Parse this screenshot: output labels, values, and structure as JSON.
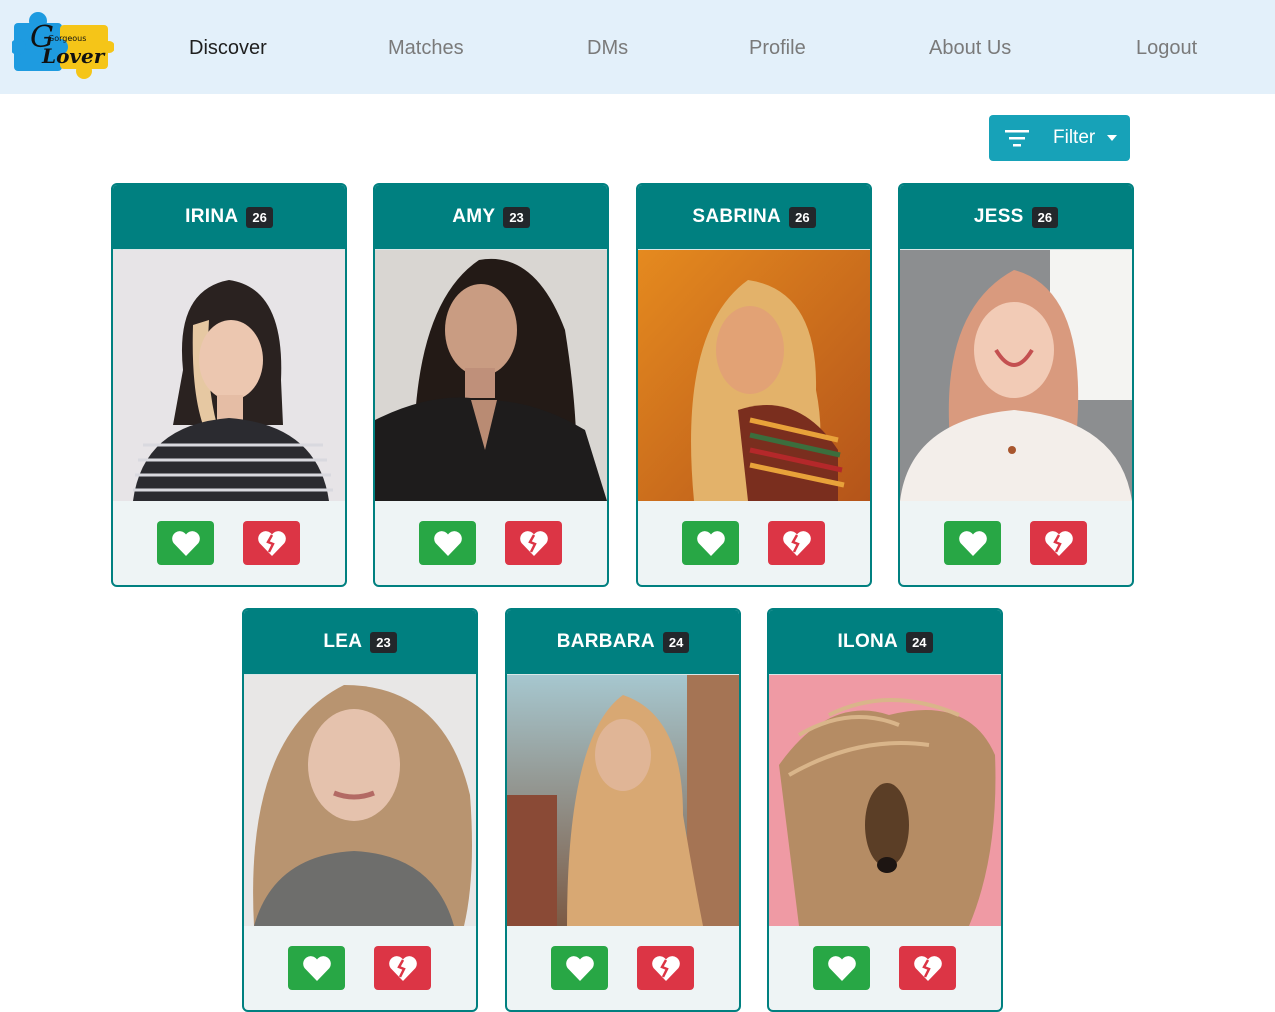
{
  "nav": {
    "items": [
      {
        "label": "Discover",
        "active": true
      },
      {
        "label": "Matches",
        "active": false
      },
      {
        "label": "DMs",
        "active": false
      },
      {
        "label": "Profile",
        "active": false
      },
      {
        "label": "About Us",
        "active": false
      },
      {
        "label": "Logout",
        "active": false
      }
    ],
    "logo_text": "Lover",
    "logo_small_text": "Gorgeous"
  },
  "filter": {
    "label": "Filter",
    "icon": "filter-icon"
  },
  "colors": {
    "navbar": "#e3f0fa",
    "card_header": "#008080",
    "filter": "#17a2b8",
    "like": "#28a745",
    "dislike": "#dc3545"
  },
  "profiles": [
    {
      "name": "IRINA",
      "age": "26"
    },
    {
      "name": "AMY",
      "age": "23"
    },
    {
      "name": "SABRINA",
      "age": "26"
    },
    {
      "name": "JESS",
      "age": "26"
    },
    {
      "name": "LEA",
      "age": "23"
    },
    {
      "name": "BARBARA",
      "age": "24"
    },
    {
      "name": "ILONA",
      "age": "24"
    }
  ]
}
